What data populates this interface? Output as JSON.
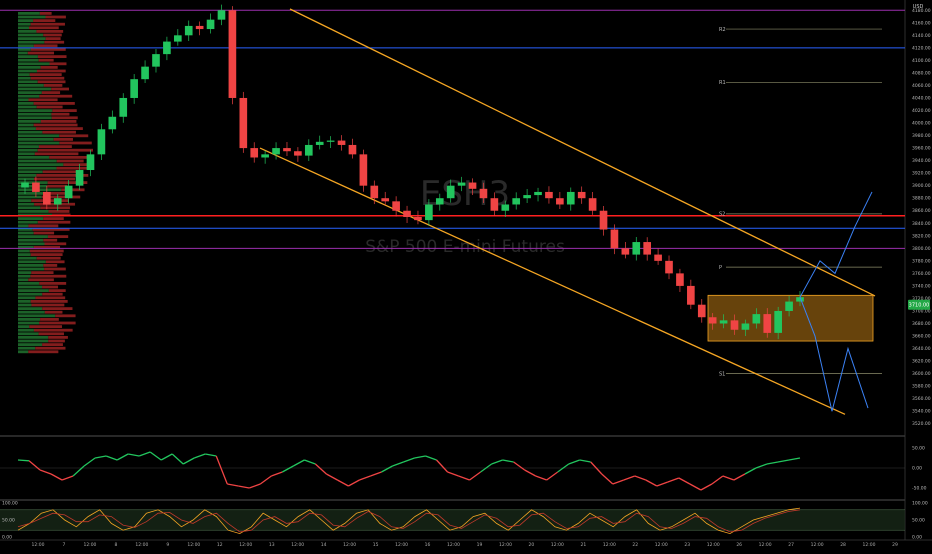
{
  "chart_data": {
    "type": "candlestick",
    "title": "S&P 500 E-mini Futures",
    "watermark": "ESH3",
    "currency": "USD",
    "colors": {
      "up": "#22c55e",
      "down": "#ef4444",
      "channel": "#f5a623",
      "hline_blue": "#2962ff",
      "hline_red": "#ff1f1f",
      "hline_purple": "#9b2fae",
      "range_box": "#8a5a10",
      "current_price_bg": "#22a846",
      "osc_line_up": "#22c55e",
      "osc_line_down": "#ef4444",
      "projection": "#3b82f6"
    },
    "price_axis": {
      "ylim": [
        3510,
        4190
      ],
      "ticks": [
        "4180.00",
        "4160.00",
        "4140.00",
        "4120.00",
        "4100.00",
        "4080.00",
        "4060.00",
        "4040.00",
        "4020.00",
        "4000.00",
        "3980.00",
        "3960.00",
        "3940.00",
        "3920.00",
        "3900.00",
        "3880.00",
        "3860.00",
        "3840.00",
        "3820.00",
        "3800.00",
        "3780.00",
        "3760.00",
        "3740.00",
        "3720.00",
        "3700.00",
        "3680.00",
        "3660.00",
        "3640.00",
        "3620.00",
        "3600.00",
        "3580.00",
        "3560.00",
        "3540.00",
        "3520.00"
      ],
      "current_price": "3710.00"
    },
    "x_axis": {
      "ticks": [
        "12:00",
        "7",
        "12:00",
        "8",
        "12:00",
        "9",
        "12:00",
        "12",
        "12:00",
        "13",
        "12:00",
        "14",
        "12:00",
        "15",
        "12:00",
        "16",
        "12:00",
        "19",
        "12:00",
        "20",
        "12:00",
        "21",
        "12:00",
        "22",
        "12:00",
        "23",
        "12:00",
        "26",
        "12:00",
        "27",
        "12:00",
        "28",
        "12:00",
        "29"
      ]
    },
    "pivot_levels": [
      {
        "label": "R2",
        "value": 4150
      },
      {
        "label": "R1",
        "value": 4065
      },
      {
        "label": "P",
        "value": 3770
      },
      {
        "label": "S1",
        "value": 3600
      },
      {
        "label": "S2",
        "value": 3855
      }
    ],
    "horizontal_lines": [
      {
        "name": "purple-top",
        "value": 4180
      },
      {
        "name": "blue-upper",
        "value": 4120
      },
      {
        "name": "red-mid",
        "value": 3852
      },
      {
        "name": "blue-lower",
        "value": 3832
      },
      {
        "name": "purple-lower",
        "value": 3800
      }
    ],
    "channel": {
      "upper": {
        "start": [
          0.0,
          4182
        ],
        "end": [
          1.0,
          3724
        ]
      },
      "lower": {
        "start": [
          0.0,
          3960
        ],
        "end": [
          1.0,
          3535
        ]
      }
    },
    "range_box": {
      "low": 3652,
      "high": 3725
    },
    "series": [
      {
        "name": "ES price",
        "values": [
          3905,
          3890,
          3870,
          3880,
          3900,
          3925,
          3950,
          3990,
          4010,
          4040,
          4070,
          4090,
          4110,
          4130,
          4140,
          4155,
          4150,
          4165,
          4180,
          4040,
          3960,
          3945,
          3950,
          3960,
          3955,
          3948,
          3965,
          3970,
          3972,
          3965,
          3950,
          3900,
          3880,
          3875,
          3860,
          3850,
          3845,
          3870,
          3880,
          3900,
          3905,
          3895,
          3880,
          3860,
          3870,
          3880,
          3885,
          3890,
          3880,
          3870,
          3890,
          3880,
          3860,
          3830,
          3800,
          3790,
          3810,
          3790,
          3780,
          3760,
          3740,
          3710,
          3690,
          3680,
          3685,
          3670,
          3680,
          3695,
          3665,
          3700,
          3715,
          3722
        ]
      }
    ],
    "rsi_panel": {
      "ticks": [
        "50.00",
        "0.00",
        "-50.00"
      ],
      "values": [
        20,
        18,
        -5,
        -15,
        -30,
        -20,
        5,
        25,
        30,
        20,
        35,
        30,
        40,
        20,
        35,
        10,
        25,
        35,
        30,
        -40,
        -45,
        -50,
        -40,
        -20,
        -10,
        5,
        20,
        10,
        -15,
        -30,
        -45,
        -30,
        -20,
        -10,
        5,
        15,
        25,
        30,
        20,
        -10,
        -20,
        -30,
        -10,
        10,
        20,
        15,
        -5,
        -20,
        -30,
        -10,
        10,
        20,
        15,
        -15,
        -40,
        -30,
        -20,
        -30,
        -45,
        -35,
        -25,
        -40,
        -55,
        -40,
        -20,
        -30,
        -15,
        0,
        10,
        15,
        20,
        25
      ]
    },
    "stoch_panel": {
      "ticks": [
        "100.00",
        "50.00",
        "0.00"
      ],
      "k": [
        20,
        40,
        70,
        80,
        50,
        30,
        60,
        80,
        40,
        20,
        30,
        70,
        80,
        60,
        30,
        50,
        80,
        60,
        20,
        10,
        30,
        70,
        50,
        30,
        60,
        80,
        50,
        20,
        40,
        70,
        80,
        40,
        20,
        30,
        60,
        80,
        50,
        20,
        30,
        60,
        70,
        40,
        20,
        50,
        80,
        60,
        30,
        20,
        40,
        70,
        50,
        30,
        60,
        80,
        40,
        20,
        30,
        50,
        70,
        40,
        20,
        10,
        30,
        50,
        60,
        70,
        80,
        85
      ],
      "d": [
        30,
        40,
        55,
        70,
        65,
        45,
        45,
        65,
        60,
        35,
        28,
        45,
        70,
        72,
        50,
        40,
        60,
        70,
        40,
        15,
        20,
        50,
        60,
        40,
        45,
        70,
        65,
        35,
        30,
        55,
        75,
        60,
        30,
        25,
        45,
        70,
        65,
        35,
        25,
        45,
        65,
        55,
        30,
        35,
        65,
        70,
        45,
        25,
        30,
        55,
        60,
        40,
        45,
        70,
        60,
        30,
        25,
        40,
        60,
        55,
        30,
        15,
        20,
        40,
        55,
        65,
        75,
        80
      ]
    }
  }
}
